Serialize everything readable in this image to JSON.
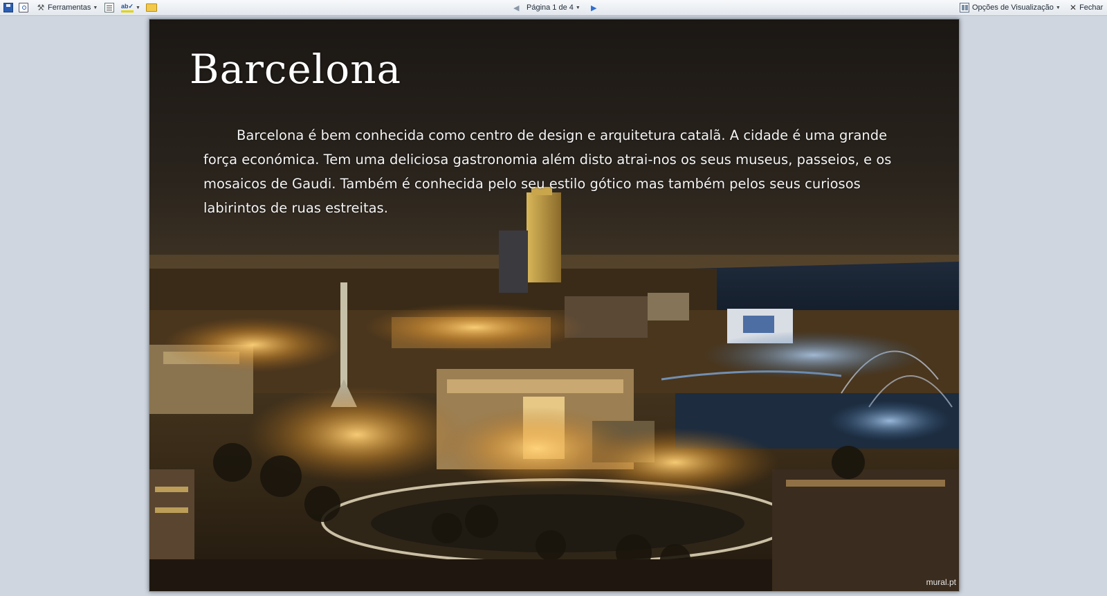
{
  "toolbar": {
    "tools_label": "Ferramentas",
    "page_indicator": "Página 1 de 4",
    "view_options_label": "Opções de Visualização",
    "close_label": "Fechar"
  },
  "document": {
    "title": "Barcelona",
    "paragraph": "Barcelona é bem conhecida como centro de design e arquitetura catalã. A cidade é uma grande força económica. Tem uma deliciosa gastronomia além disto atrai-nos os seus museus, passeios, e os mosaicos de Gaudi. Também é conhecida pelo seu estilo gótico mas também pelos seus curiosos labirintos de ruas estreitas.",
    "image_watermark": "mural.pt"
  },
  "colors": {
    "toolbar_bg": "#e9edf2",
    "workspace_bg": "#cfd6df",
    "text_on_photo": "#ffffff",
    "next_arrow": "#2f6fcf"
  },
  "icons": [
    "save-icon",
    "print-preview-icon",
    "tools-icon",
    "research-icon",
    "spelling-icon",
    "folder-icon",
    "view-options-icon",
    "close-icon"
  ]
}
